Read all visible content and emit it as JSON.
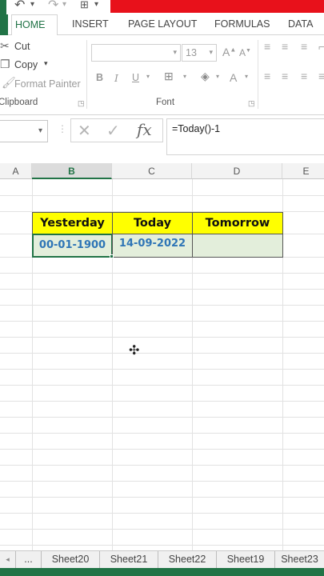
{
  "tabs": {
    "home": "HOME",
    "insert": "INSERT",
    "page_layout": "PAGE LAYOUT",
    "formulas": "FORMULAS",
    "data": "DATA"
  },
  "clipboard": {
    "cut": "Cut",
    "copy": "Copy",
    "format_painter": "Format Painter",
    "group_label": "Clipboard"
  },
  "font": {
    "size": "13",
    "group_label": "Font",
    "bold": "B",
    "italic": "I",
    "underline": "U"
  },
  "formula_bar": {
    "cancel": "✕",
    "enter": "✓",
    "fx": "fx",
    "formula": "=Today()-1"
  },
  "columns": [
    "A",
    "B",
    "C",
    "D",
    "E"
  ],
  "selected_column": "B",
  "table": {
    "headers": [
      "Yesterday",
      "Today",
      "Tomorrow"
    ],
    "values": [
      "00-01-1900",
      "14-09-2022",
      ""
    ]
  },
  "sheets": {
    "more": "...",
    "tabs": [
      "Sheet20",
      "Sheet21",
      "Sheet22",
      "Sheet19",
      "Sheet23"
    ]
  },
  "colors": {
    "accent": "#217346",
    "header_fill": "#ffff00",
    "value_fill": "#e3eedb",
    "value_text": "#2e75b6"
  }
}
